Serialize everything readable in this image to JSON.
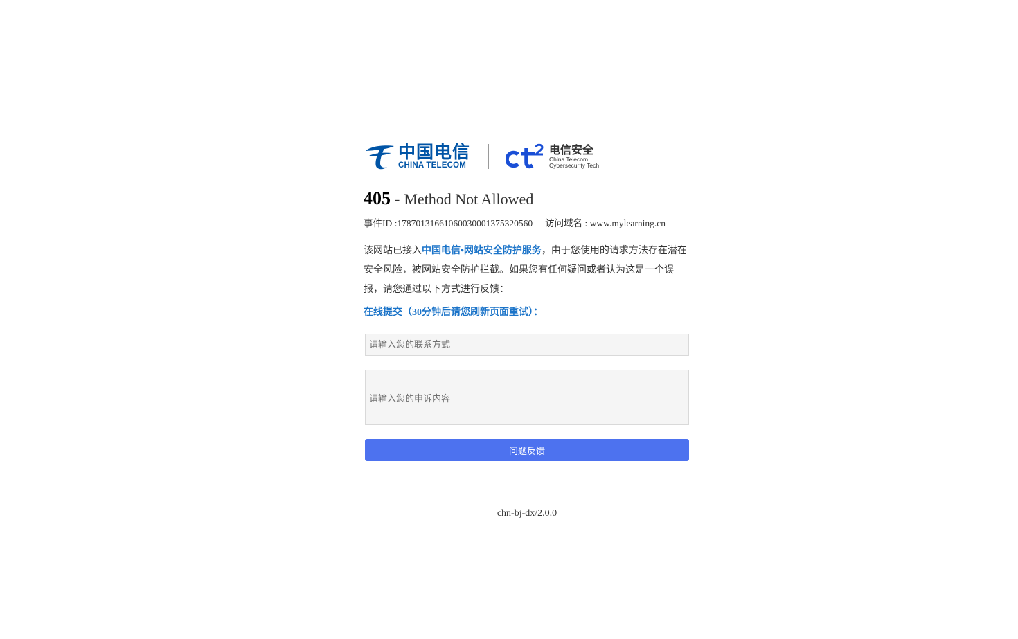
{
  "logos": {
    "china_telecom_cn": "中国电信",
    "china_telecom_en": "CHINA TELECOM",
    "security_icon_text": "ct",
    "security_icon_sup": "2",
    "security_cn": "电信安全",
    "security_en_line1": "China Telecom",
    "security_en_line2": "Cybersecurity Tech",
    "brand_color": "#0054a6",
    "security_color": "#1a4fd6"
  },
  "error": {
    "code": "405",
    "separator": "-",
    "message": "Method Not Allowed"
  },
  "meta": {
    "event_id_label": "事件ID :",
    "event_id": "17870131661060030001375320560",
    "domain_label": "访问域名 :",
    "domain": "www.mylearning.cn"
  },
  "description": {
    "prefix": "该网站已接入",
    "highlight": "中国电信•网站安全防护服务",
    "suffix": "，由于您使用的请求方法存在潜在安全风险，被网站安全防护拦截。如果您有任何疑问或者认为这是一个误报，请您通过以下方式进行反馈："
  },
  "form": {
    "title": "在线提交（30分钟后请您刷新页面重试）：",
    "contact_placeholder": "请输入您的联系方式",
    "contact_value": "",
    "appeal_placeholder": "请输入您的申诉内容",
    "appeal_value": "",
    "submit_label": "问题反馈",
    "button_color": "#4d72ef"
  },
  "footer": {
    "version": "chn-bj-dx/2.0.0"
  }
}
